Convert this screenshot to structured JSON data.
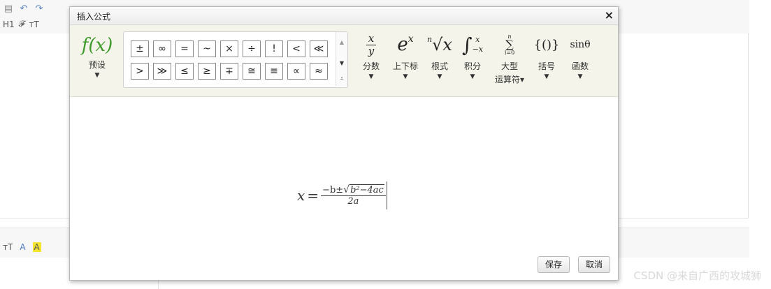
{
  "background": {
    "toolbar_row2": [
      "H1",
      "𝓕",
      "ᴛT"
    ],
    "toolbar_row3": [
      "ᴛT",
      "A",
      "A"
    ]
  },
  "dialog": {
    "title": "插入公式",
    "close": "×",
    "preset": {
      "icon": "f(x)",
      "label": "预设"
    },
    "symbols": [
      "±",
      "∞",
      "=",
      "~",
      "×",
      "÷",
      "!",
      "<",
      "≪",
      ">",
      "≫",
      "≤",
      "≥",
      "∓",
      "≅",
      "≡",
      "∝",
      "≈"
    ],
    "tools": [
      {
        "label": "分数"
      },
      {
        "label": "上下标"
      },
      {
        "label": "根式"
      },
      {
        "label": "积分"
      },
      {
        "label": "大型",
        "sub": "运算符▾"
      },
      {
        "label": "括号"
      },
      {
        "label": "函数"
      }
    ],
    "buttons": {
      "save": "保存",
      "cancel": "取消"
    }
  },
  "formula": {
    "lhs": "x",
    "eq": "=",
    "num_prefix": "−b±",
    "radicand": "b²−4ac",
    "den": "2a"
  },
  "watermark": "CSDN @来自广西的攻城狮"
}
